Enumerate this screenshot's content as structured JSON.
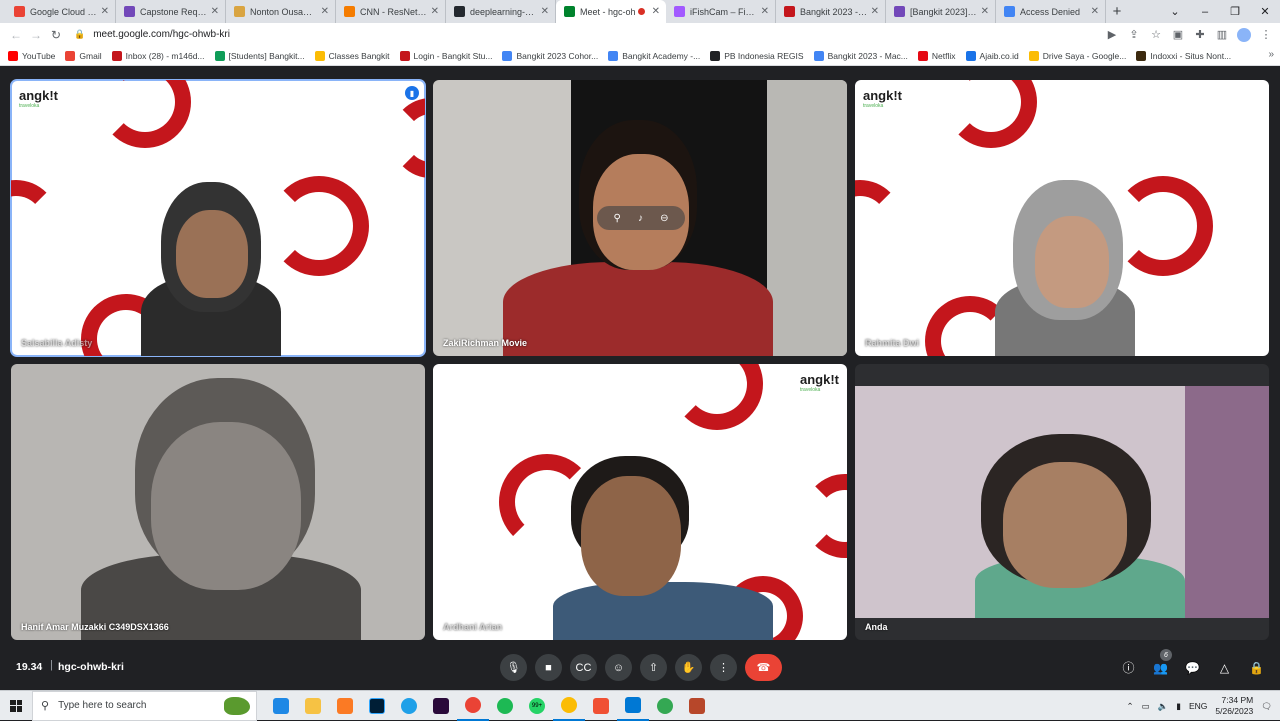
{
  "browser": {
    "tabs": [
      {
        "label": "Google Cloud Cred",
        "color": "#ea4335"
      },
      {
        "label": "Capstone Request",
        "color": "#7248b9"
      },
      {
        "label": "Nonton Ousama R",
        "color": "#d9a441"
      },
      {
        "label": "CNN - ResNet50.ip",
        "color": "#f57c00"
      },
      {
        "label": "deeplearning-mod",
        "color": "#24292f"
      },
      {
        "label": "Meet - hgc-oh",
        "color": "#00832d",
        "active": true
      },
      {
        "label": "iFishCam – Figma",
        "color": "#a259ff"
      },
      {
        "label": "Bangkit 2023 - Pro",
        "color": "#c4161c"
      },
      {
        "label": "[Bangkit 2023] - Pr",
        "color": "#7248b9"
      },
      {
        "label": "Access Denied",
        "color": "#4285f4"
      }
    ],
    "url": "meet.google.com/hgc-ohwb-kri",
    "bookmarks": [
      {
        "label": "YouTube",
        "color": "#ff0000"
      },
      {
        "label": "Gmail",
        "color": "#ea4335"
      },
      {
        "label": "Inbox (28) - m146d...",
        "color": "#c4161c"
      },
      {
        "label": "[Students] Bangkit...",
        "color": "#0f9d58"
      },
      {
        "label": "Classes Bangkit",
        "color": "#fbbc04"
      },
      {
        "label": "Login - Bangkit Stu...",
        "color": "#c4161c"
      },
      {
        "label": "Bangkit 2023 Cohor...",
        "color": "#4285f4"
      },
      {
        "label": "Bangkit Academy -...",
        "color": "#4285f4"
      },
      {
        "label": "PB Indonesia REGIS",
        "color": "#202124"
      },
      {
        "label": "Bangkit 2023 - Mac...",
        "color": "#4285f4"
      },
      {
        "label": "Netflix",
        "color": "#e50914"
      },
      {
        "label": "Ajaib.co.id",
        "color": "#1a73e8"
      },
      {
        "label": "Drive Saya - Google...",
        "color": "#fbbc04"
      },
      {
        "label": "Indoxxi - Situs Nont...",
        "color": "#3c2a0f"
      }
    ]
  },
  "meet": {
    "participants": [
      {
        "name": "Salsabilla Adisty"
      },
      {
        "name": "ZakiRichman Movie"
      },
      {
        "name": "Rahmita Dwi"
      },
      {
        "name": "Hanif Amar Muzakki C349DSX1366"
      },
      {
        "name": "Ardhani Arian"
      },
      {
        "name": "Anda"
      }
    ],
    "bangkit_logo": "angk!t",
    "partner_logo": "traveloka",
    "time": "19.34",
    "meeting_code": "hgc-ohwb-kri",
    "people_count": "6",
    "colors": {
      "accent": "#8ab4f8",
      "end_call": "#ea4335",
      "bangkit_red": "#c4161c"
    }
  },
  "taskbar": {
    "search_placeholder": "Type here to search",
    "badge": "99+",
    "language": "ENG",
    "time": "7:34 PM",
    "date": "5/26/2023"
  }
}
